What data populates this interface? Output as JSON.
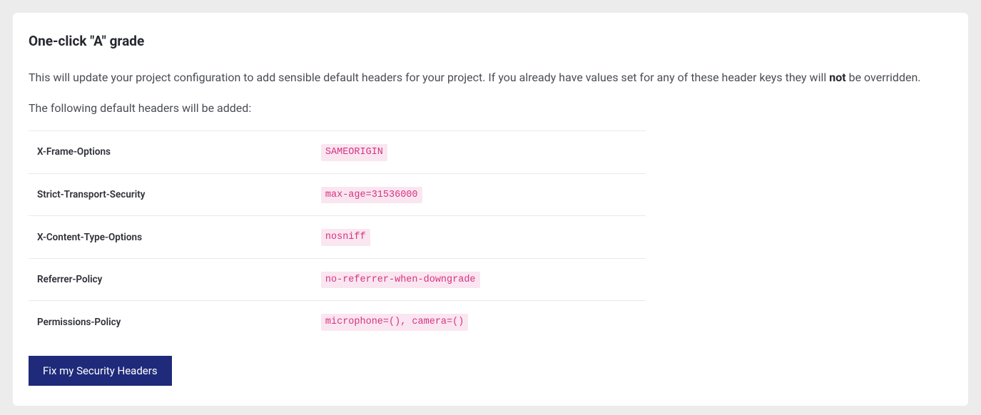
{
  "title": "One-click \"A\" grade",
  "description_pre": "This will update your project configuration to add sensible default headers for your project. If you already have values set for any of these header keys they will ",
  "description_bold": "not",
  "description_post": " be overridden.",
  "subhead": "The following default headers will be added:",
  "headers": [
    {
      "name": "X-Frame-Options",
      "value": "SAMEORIGIN"
    },
    {
      "name": "Strict-Transport-Security",
      "value": "max-age=31536000"
    },
    {
      "name": "X-Content-Type-Options",
      "value": "nosniff"
    },
    {
      "name": "Referrer-Policy",
      "value": "no-referrer-when-downgrade"
    },
    {
      "name": "Permissions-Policy",
      "value": "microphone=(), camera=()"
    }
  ],
  "button_label": "Fix my Security Headers"
}
